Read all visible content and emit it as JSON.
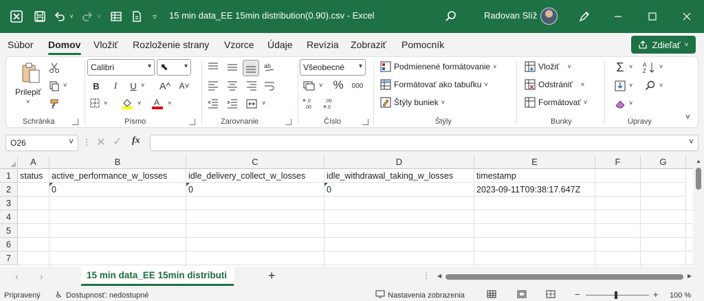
{
  "titlebar": {
    "doc_title": "15 min data_EE 15min distribution(0.90).csv  -  Excel",
    "user_name": "Radovan Slíž",
    "icons": [
      "excel-logo-icon",
      "save-icon",
      "undo-icon",
      "redo-icon",
      "form-icon",
      "touch-mode-icon",
      "customize-icon",
      "search-icon",
      "pen-icon",
      "minimize-icon",
      "maximize-icon",
      "close-icon"
    ]
  },
  "menu": {
    "items": [
      "Súbor",
      "Domov",
      "Vložiť",
      "Rozloženie strany",
      "Vzorce",
      "Údaje",
      "Revízia",
      "Zobraziť",
      "Pomocník"
    ],
    "active": "Domov",
    "share_label": "Zdieľať"
  },
  "ribbon": {
    "clipboard": {
      "label": "Schránka",
      "paste_label": "Prilepiť"
    },
    "font": {
      "label": "Písmo",
      "font_name": "Calibri",
      "font_size": "",
      "bold": "B",
      "italic": "I",
      "underline": "U",
      "grow": "A^",
      "shrink": "A˅"
    },
    "alignment": {
      "label": "Zarovnanie"
    },
    "number": {
      "label": "Číslo",
      "format": "Všeobecné",
      "percent": "%",
      "thousands": "000"
    },
    "styles": {
      "label": "Štýly",
      "conditional": "Podmienené formátovanie",
      "as_table": "Formátovať ako tabuľku",
      "cell_styles": "Štýly buniek"
    },
    "cells": {
      "label": "Bunky",
      "insert": "Vložiť",
      "delete": "Odstrániť",
      "format": "Formátovať"
    },
    "editing": {
      "label": "Úpravy"
    }
  },
  "formula_bar": {
    "name_box": "O26",
    "fx": "fx",
    "content": ""
  },
  "sheet": {
    "columns": [
      "A",
      "B",
      "C",
      "D",
      "E",
      "F",
      "G"
    ],
    "rows": [
      "1",
      "2",
      "3",
      "4",
      "5",
      "6",
      "7"
    ],
    "header_row": [
      "status",
      "active_performance_w_losses",
      "idle_delivery_collect_w_losses",
      "idle_withdrawal_taking_w_losses",
      "timestamp",
      "",
      ""
    ],
    "data_row": [
      "",
      "0",
      "0",
      "0",
      "2023-09-11T09:38:17.647Z",
      "",
      ""
    ]
  },
  "tabs": {
    "sheet_name": "15 min data_EE 15min distributi",
    "add": "+"
  },
  "status": {
    "ready": "Pripravený",
    "accessibility": "Dostupnosť: nedostupné",
    "display_settings": "Nastavenia zobrazenia",
    "zoom": "100 %",
    "zoom_minus": "−",
    "zoom_plus": "+"
  },
  "colors": {
    "brand": "#1d7144",
    "ribbon_bg": "#ffffff",
    "app_bg": "#f3f3f3"
  }
}
